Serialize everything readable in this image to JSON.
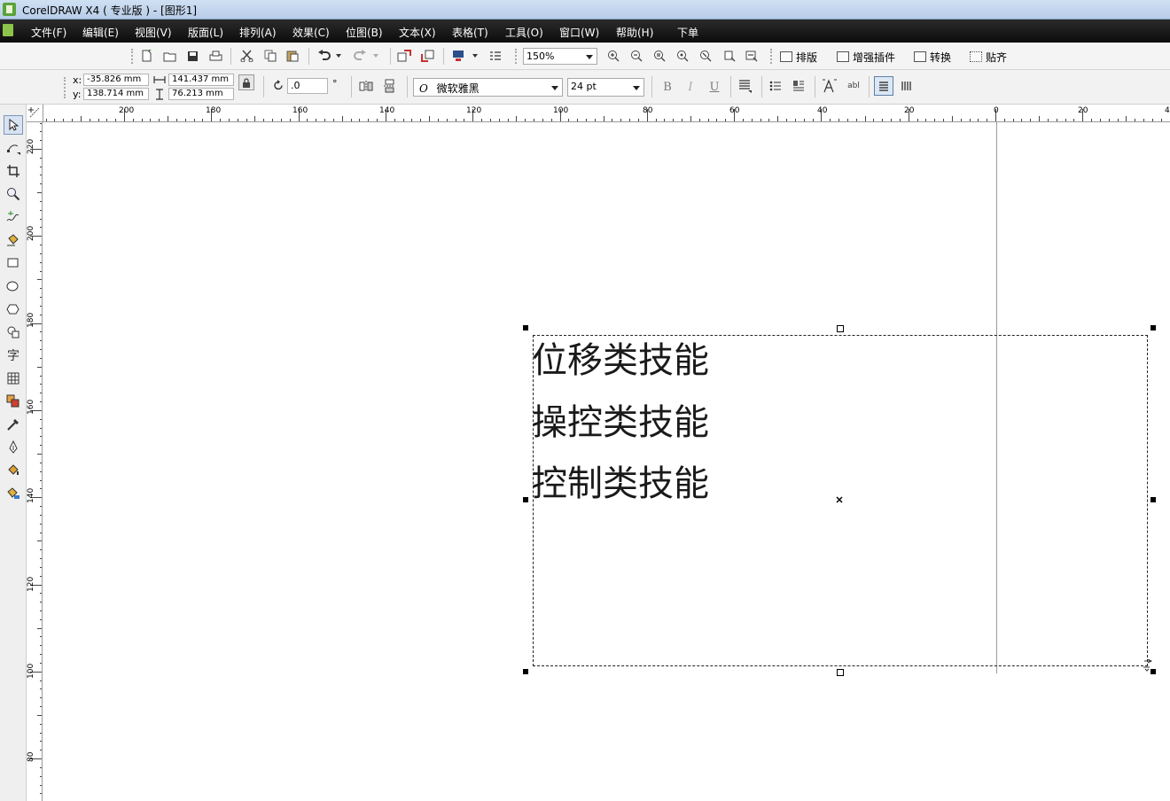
{
  "window": {
    "title": "CorelDRAW X4 ( 专业版 ) - [图形1]"
  },
  "menu": {
    "items": [
      "文件(F)",
      "编辑(E)",
      "视图(V)",
      "版面(L)",
      "排列(A)",
      "效果(C)",
      "位图(B)",
      "文本(X)",
      "表格(T)",
      "工具(O)",
      "窗口(W)",
      "帮助(H)",
      "下单"
    ]
  },
  "toolbar": {
    "zoom": "150%",
    "buttons": [
      "排版",
      "增强插件",
      "转换",
      "贴齐"
    ]
  },
  "property_bar": {
    "x_label": "x:",
    "x_value": "-35.826 mm",
    "y_label": "y:",
    "y_value": "138.714 mm",
    "width_value": "141.437 mm",
    "height_value": "76.213 mm",
    "rotation": ".0",
    "degree": "°",
    "font_glyph": "O",
    "font_name": "微软雅黑",
    "font_size": "24 pt",
    "bold": "B",
    "italic": "I",
    "underline": "U",
    "char_format_sample": "abl"
  },
  "rulers": {
    "horizontal": [
      "200",
      "180",
      "160",
      "140",
      "120",
      "100",
      "80",
      "60",
      "40",
      "20",
      "0",
      "20",
      "4"
    ],
    "vertical": [
      "220",
      "200",
      "180",
      "160",
      "140",
      "120",
      "100",
      "80"
    ]
  },
  "canvas": {
    "lines": [
      "位移类技能",
      "操控类技能",
      "控制类技能"
    ]
  }
}
